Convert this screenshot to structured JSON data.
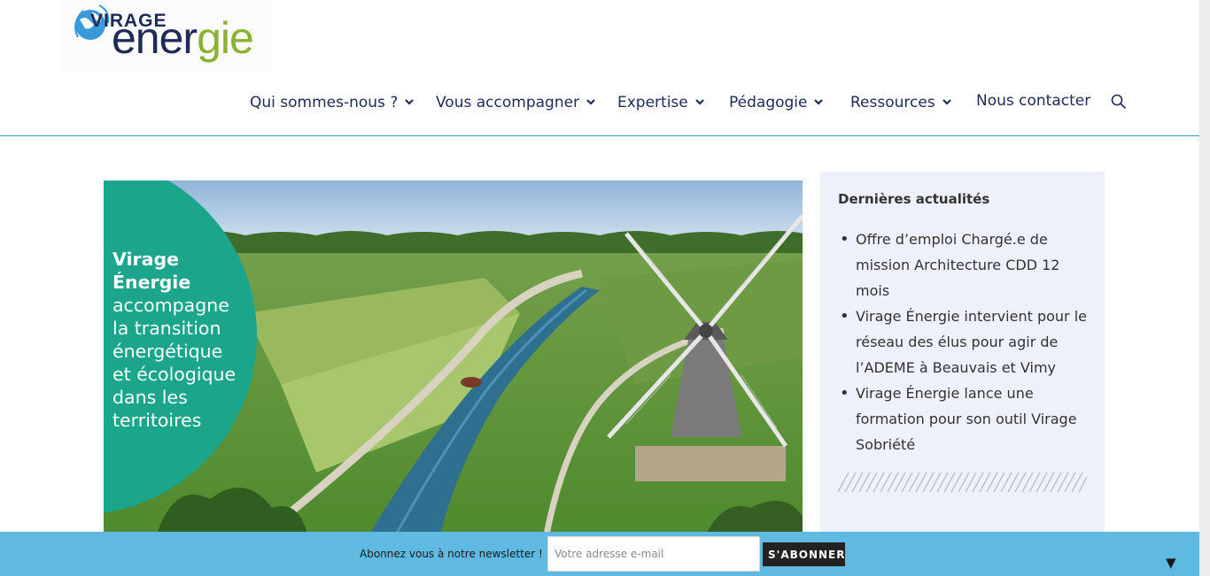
{
  "logo": {
    "top": "VIRAGE",
    "main_a": "ener",
    "main_g": "g",
    "main_b": "ie"
  },
  "nav": {
    "items": [
      {
        "label": "Qui sommes-nous ?"
      },
      {
        "label": "Vous accompagner"
      },
      {
        "label": "Expertise"
      },
      {
        "label": "Pédagogie"
      },
      {
        "label": "Ressources"
      },
      {
        "label": "Nous contacter"
      }
    ],
    "search_icon": "search-icon"
  },
  "hero": {
    "line1": "Virage",
    "line2": "Énergie",
    "line3": "accompagne",
    "line4": "la transition",
    "line5": "énergétique",
    "line6": "et écologique",
    "line7": "dans les",
    "line8": "territoires"
  },
  "sidebar": {
    "title": "Dernières actualités",
    "items": [
      {
        "text": "Offre d’emploi Chargé.e de mission Architecture CDD 12 mois"
      },
      {
        "text": "Virage Énergie intervient pour le réseau des élus pour agir de l’ADEME à Beauvais et Vimy"
      },
      {
        "text": "Virage Énergie lance une formation pour son outil Virage Sobriété"
      }
    ]
  },
  "newsletter": {
    "label": "Abonnez vous à notre newsletter !",
    "placeholder": "Votre adresse e-mail",
    "button": "S'ABONNER",
    "toggle": "▼"
  },
  "colors": {
    "navy": "#1e2a57",
    "green": "#8bb132",
    "teal": "#1ba58a",
    "bar": "#5fb9e0"
  }
}
